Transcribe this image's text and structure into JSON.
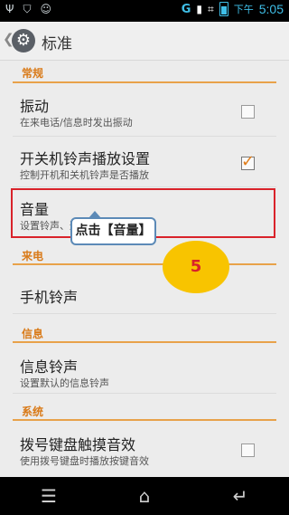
{
  "status": {
    "left_icons": [
      "usb-icon",
      "shield-icon",
      "android-icon"
    ],
    "signal_label": "G",
    "ampm": "下午",
    "time": "5:05"
  },
  "actionbar": {
    "title": "标准"
  },
  "sections": {
    "general": "常规",
    "incoming": "来电",
    "message": "信息",
    "system": "系统"
  },
  "items": {
    "vibrate": {
      "title": "振动",
      "subtitle": "在来电话/信息时发出振动",
      "checked": false
    },
    "boot_sound": {
      "title": "开关机铃声播放设置",
      "subtitle": "控制开机和关机铃声是否播放",
      "checked": true
    },
    "volume": {
      "title": "音量",
      "subtitle": "设置铃声、通知音量"
    },
    "ringtone": {
      "title": "手机铃声"
    },
    "message_tone": {
      "title": "信息铃声",
      "subtitle": "设置默认的信息铃声"
    },
    "dial_tone": {
      "title": "拨号键盘触摸音效",
      "subtitle": "使用拨号键盘时播放按键音效",
      "checked": false
    }
  },
  "annotation": {
    "callout": "点击【音量】",
    "step": "5"
  },
  "nav": {
    "icons": [
      "menu-icon",
      "home-icon",
      "back-icon"
    ]
  }
}
